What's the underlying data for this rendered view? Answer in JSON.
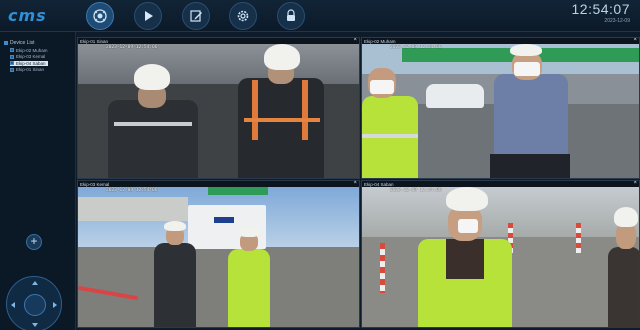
{
  "app": {
    "logo": "cms"
  },
  "toolbar": {
    "buttons": [
      {
        "name": "camera-grid",
        "icon": "camera-icon",
        "active": true
      },
      {
        "name": "play",
        "icon": "play-icon",
        "active": false
      },
      {
        "name": "edit",
        "icon": "edit-icon",
        "active": false
      },
      {
        "name": "settings",
        "icon": "gear-icon",
        "active": false
      },
      {
        "name": "lock",
        "icon": "lock-icon",
        "active": false
      }
    ]
  },
  "clock": {
    "time": "12:54:07",
    "date": "2023-12-09"
  },
  "sidebar": {
    "tree_root": "Device List",
    "items": [
      {
        "label": "Ekip-02 Muham",
        "selected": false
      },
      {
        "label": "Ekip-03 Kemal",
        "selected": false
      },
      {
        "label": "Ekip-04 Saban",
        "selected": true
      },
      {
        "label": "Ekip-01 Sinan",
        "selected": false
      }
    ],
    "add_label": "+"
  },
  "tiles": [
    {
      "name": "Ekip-01 Sinan",
      "timestamp": "2023-12-09 12:54:06"
    },
    {
      "name": "Ekip-02 Muham",
      "timestamp": "2023-12-09 12:54:06"
    },
    {
      "name": "Ekip-03 Kemal",
      "timestamp": "2023-12-09 12:54:06"
    },
    {
      "name": "Ekip-04 Saban",
      "timestamp": "2023-12-09 12:54:06"
    }
  ],
  "colors": {
    "accent": "#2f8fd8",
    "background": "#0d1b2a",
    "vest": "#b6e23a"
  }
}
